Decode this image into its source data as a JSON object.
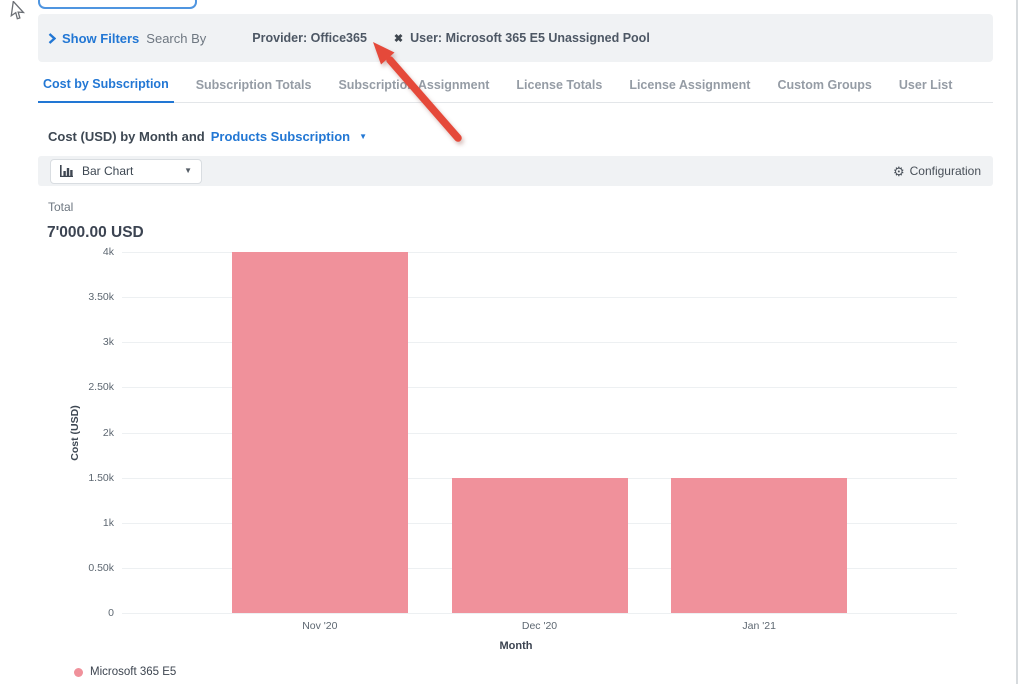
{
  "filter_bar": {
    "show_filters_label": "Show Filters",
    "search_by_label": "Search By",
    "provider_filter": "Provider: Office365",
    "user_filter": "User: Microsoft 365 E5 Unassigned Pool",
    "remove_glyph": "✖"
  },
  "tabs": [
    {
      "label": "Cost by Subscription",
      "active": true
    },
    {
      "label": "Subscription Totals",
      "active": false
    },
    {
      "label": "Subscription Assignment",
      "active": false
    },
    {
      "label": "License Totals",
      "active": false
    },
    {
      "label": "License Assignment",
      "active": false
    },
    {
      "label": "Custom Groups",
      "active": false
    },
    {
      "label": "User List",
      "active": false
    }
  ],
  "heading": {
    "prefix": "Cost (USD) by Month and",
    "dropdown_label": "Products Subscription",
    "caret_glyph": "▼"
  },
  "toolbar": {
    "chart_type_selected": "Bar Chart",
    "chart_type_caret": "▼",
    "configuration_label": "Configuration",
    "gear_glyph": "⚙"
  },
  "summary": {
    "label": "Total",
    "value": "7'000.00 USD"
  },
  "chart_data": {
    "type": "bar",
    "categories": [
      "Nov '20",
      "Dec '20",
      "Jan '21"
    ],
    "series": [
      {
        "name": "Microsoft 365 E5",
        "color": "#f0919b",
        "values": [
          4000,
          1500,
          1500
        ]
      }
    ],
    "xlabel": "Month",
    "ylabel": "Cost (USD)",
    "ylim": [
      0,
      4000
    ],
    "yticks": [
      {
        "value": 4000,
        "label": "4k"
      },
      {
        "value": 3500,
        "label": "3.50k"
      },
      {
        "value": 3000,
        "label": "3k"
      },
      {
        "value": 2500,
        "label": "2.50k"
      },
      {
        "value": 2000,
        "label": "2k"
      },
      {
        "value": 1500,
        "label": "1.50k"
      },
      {
        "value": 1000,
        "label": "1k"
      },
      {
        "value": 500,
        "label": "0.50k"
      },
      {
        "value": 0,
        "label": "0"
      }
    ],
    "grid": true,
    "legend_position": "bottom-left",
    "total_label": "Total",
    "total_value": "7'000.00 USD"
  },
  "icons": {
    "show_filters": "chevron-right-icon",
    "remove_filter": "x-icon",
    "chart_type": "bar-chart-icon",
    "dropdown": "caret-down-icon",
    "configuration": "gear-icon",
    "annotation": "red-arrow",
    "pointer": "mouse-cursor"
  },
  "colors": {
    "accent_blue": "#2277d4",
    "bar_pink": "#f0919b",
    "arrow_red": "#e5493a",
    "panel_gray": "#f0f2f4"
  }
}
